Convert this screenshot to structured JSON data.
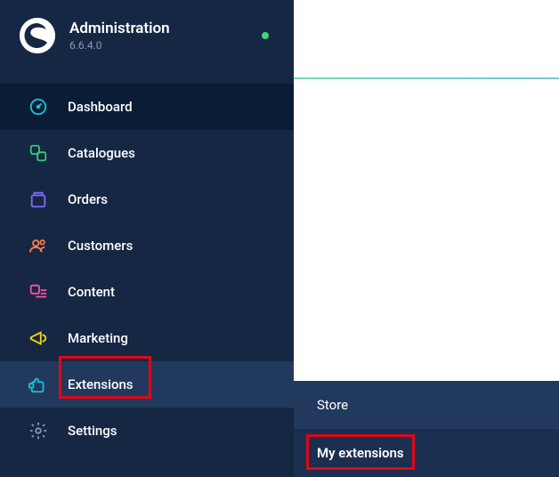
{
  "header": {
    "title": "Administration",
    "version": "6.6.4.0"
  },
  "nav": {
    "dashboard": "Dashboard",
    "catalogues": "Catalogues",
    "orders": "Orders",
    "customers": "Customers",
    "content": "Content",
    "marketing": "Marketing",
    "extensions": "Extensions",
    "settings": "Settings"
  },
  "submenu": {
    "store": "Store",
    "my_extensions": "My extensions"
  }
}
